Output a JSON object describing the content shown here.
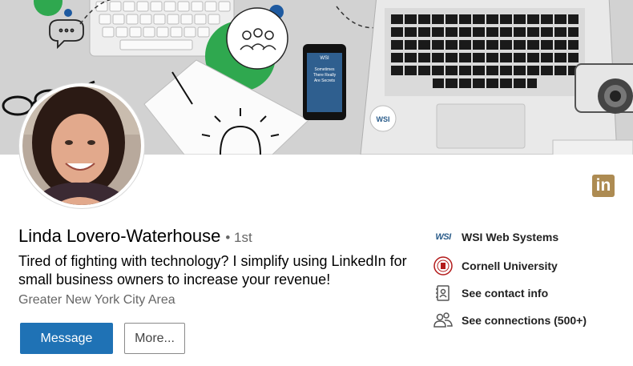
{
  "profile": {
    "name": "Linda Lovero-Waterhouse",
    "degree": "• 1st",
    "headline": "Tired of fighting with technology? I simplify using LinkedIn for small business owners to increase your revenue!",
    "location": "Greater New York City Area"
  },
  "actions": {
    "message_label": "Message",
    "more_label": "More..."
  },
  "brand": {
    "linkedin_badge_text": "in",
    "linkedin_badge_color": "#ad8b52",
    "primary_button_color": "#1f72b5"
  },
  "sidebar": {
    "items": [
      {
        "icon": "wsi-logo-icon",
        "logo_text": "WSI",
        "label": "WSI Web Systems"
      },
      {
        "icon": "cornell-seal-icon",
        "label": "Cornell University"
      },
      {
        "icon": "contact-card-icon",
        "label": "See contact info"
      },
      {
        "icon": "people-icon",
        "label": "See connections (500+)"
      }
    ]
  },
  "banner": {
    "phone_screen_text": "Sometimes There Really Are Secrets",
    "phone_brand": "WSI",
    "laptop_sticker": "WSI"
  }
}
